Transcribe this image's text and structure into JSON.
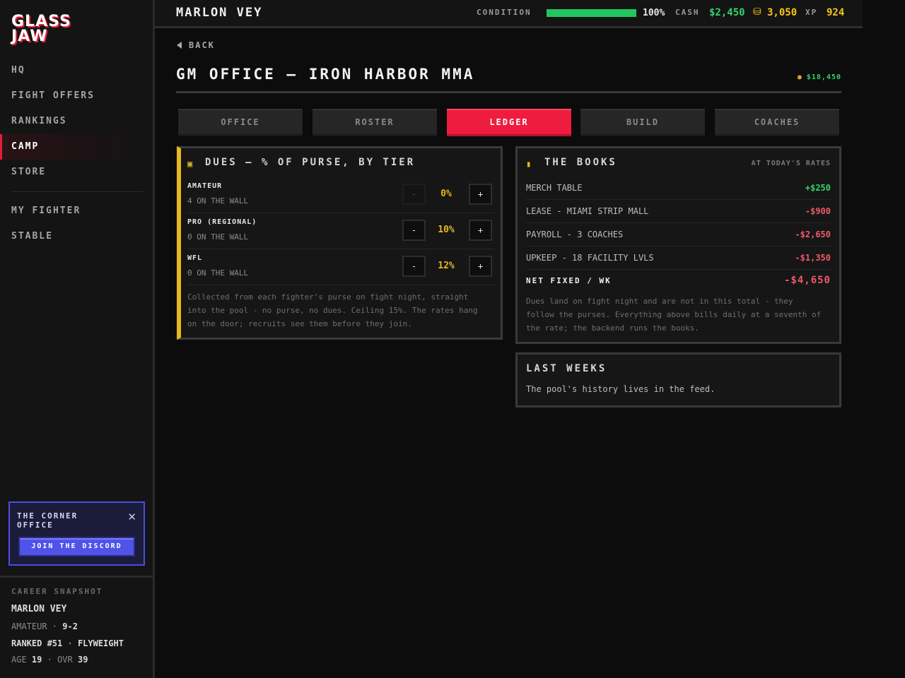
{
  "sidebar": {
    "logo": "GLASS JAW",
    "nav": [
      {
        "label": "HQ",
        "active": false
      },
      {
        "label": "FIGHT OFFERS",
        "active": false
      },
      {
        "label": "RANKINGS",
        "active": false
      },
      {
        "label": "CAMP",
        "active": true
      },
      {
        "label": "STORE",
        "active": false
      },
      {
        "label": "MY FIGHTER",
        "active": false
      },
      {
        "label": "STABLE",
        "active": false
      }
    ],
    "promo": {
      "title": "THE CORNER OFFICE",
      "close_icon": "close-icon",
      "button": "JOIN THE DISCORD"
    },
    "snapshot": {
      "title": "CAREER SNAPSHOT",
      "name": "MARLON VEY",
      "tier": "AMATEUR",
      "record": "9-2",
      "rank": "RANKED #51",
      "division": "FLYWEIGHT",
      "age_label": "AGE",
      "age": "19",
      "ovr_label": "OVR",
      "ovr": "39"
    }
  },
  "topbar": {
    "fighter": "MARLON VEY",
    "condition_label": "CONDITION",
    "condition_pct": 100,
    "condition_text": "100%",
    "cash_label": "CASH",
    "cash": "$2,450",
    "coin_icon": "coins-icon",
    "coins": "3,050",
    "xp_label": "XP",
    "xp": "924"
  },
  "main": {
    "back": "BACK",
    "title": "GM OFFICE — IRON HARBOR MMA",
    "bank_icon": "money-bag-icon",
    "bank": "$18,450",
    "tabs": [
      {
        "label": "OFFICE",
        "active": false
      },
      {
        "label": "ROSTER",
        "active": false
      },
      {
        "label": "LEDGER",
        "active": true
      },
      {
        "label": "BUILD",
        "active": false
      },
      {
        "label": "COACHES",
        "active": false
      }
    ]
  },
  "dues": {
    "icon": "ticket-icon",
    "title": "DUES — % OF PURSE, BY TIER",
    "tiers": [
      {
        "name": "AMATEUR",
        "sub": "4 ON THE WALL",
        "value": "0%",
        "minus": "-",
        "plus": "+"
      },
      {
        "name": "PRO (REGIONAL)",
        "sub": "0 ON THE WALL",
        "value": "10%",
        "minus": "-",
        "plus": "+"
      },
      {
        "name": "WFL",
        "sub": "0 ON THE WALL",
        "value": "12%",
        "minus": "-",
        "plus": "+"
      }
    ],
    "note": "Collected from each fighter's purse on fight night, straight into the pool - no purse, no dues. Ceiling 15%. The rates hang on the door; recruits see them before they join."
  },
  "books": {
    "icon": "ledger-icon",
    "title": "THE BOOKS",
    "subtitle": "AT TODAY'S RATES",
    "rows": [
      {
        "label": "MERCH TABLE",
        "value": "+$250",
        "kind": "pos"
      },
      {
        "label": "LEASE - MIAMI STRIP MALL",
        "value": "-$900",
        "kind": "neg"
      },
      {
        "label": "PAYROLL - 3 COACHES",
        "value": "-$2,650",
        "kind": "neg"
      },
      {
        "label": "UPKEEP - 18 FACILITY LVLS",
        "value": "-$1,350",
        "kind": "neg"
      }
    ],
    "net_label": "NET FIXED / WK",
    "net_value": "-$4,650",
    "note": "Dues land on fight night and are not in this total - they follow the purses. Everything above bills daily at a seventh of the rate; the backend runs the books."
  },
  "last_weeks": {
    "title": "LAST WEEKS",
    "text": "The pool's history lives in the feed."
  }
}
